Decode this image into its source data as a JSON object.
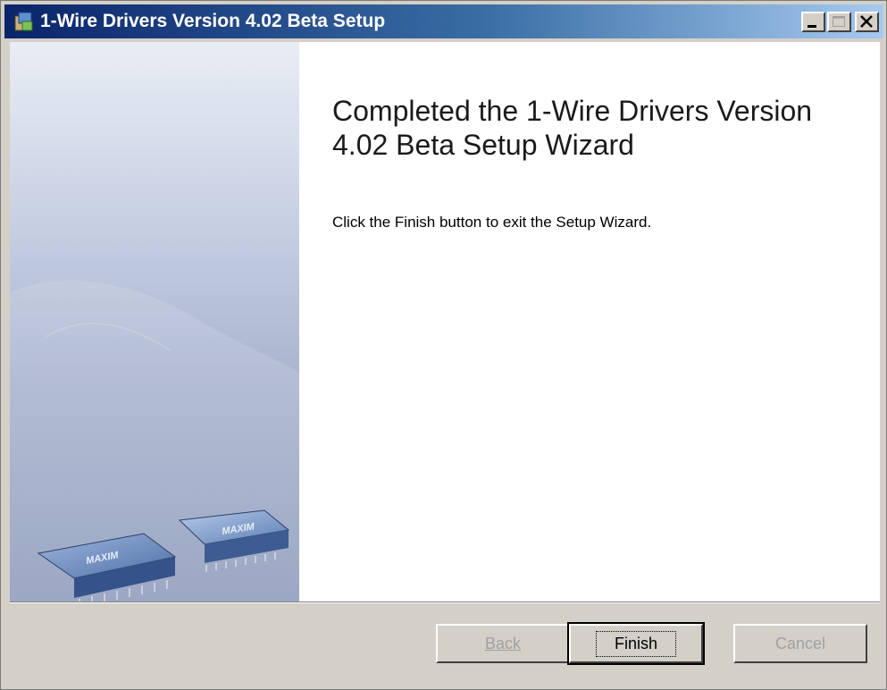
{
  "window": {
    "title": "1-Wire Drivers Version 4.02 Beta Setup"
  },
  "main": {
    "heading": "Completed the 1-Wire Drivers Version 4.02 Beta Setup Wizard",
    "message": "Click the Finish button to exit the Setup Wizard."
  },
  "graphic": {
    "chip_label": "MAXIM"
  },
  "buttons": {
    "back": "Back",
    "finish": "Finish",
    "cancel": "Cancel"
  },
  "colors": {
    "titlebar_start": "#0a246a",
    "titlebar_end": "#a6caf0",
    "panel_top": "#e9edf5",
    "panel_bottom": "#8e9cbc",
    "chrome": "#d4d0c8"
  }
}
